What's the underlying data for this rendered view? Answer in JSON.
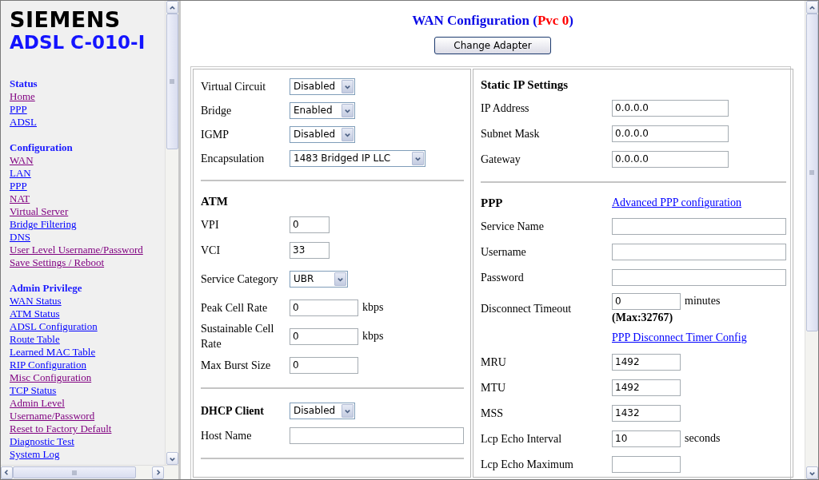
{
  "sidebar": {
    "brand": "SIEMENS",
    "model": "ADSL C-010-I",
    "sections": [
      {
        "title": "Status",
        "links": [
          {
            "label": "Home",
            "visited": true
          },
          {
            "label": "PPP",
            "visited": false
          },
          {
            "label": "ADSL",
            "visited": false
          }
        ]
      },
      {
        "title": "Configuration",
        "links": [
          {
            "label": "WAN",
            "visited": true
          },
          {
            "label": "LAN",
            "visited": false
          },
          {
            "label": "PPP",
            "visited": false
          },
          {
            "label": "NAT",
            "visited": true
          },
          {
            "label": "Virtual Server",
            "visited": true
          },
          {
            "label": "Bridge Filtering",
            "visited": false
          },
          {
            "label": "DNS",
            "visited": false
          },
          {
            "label": "User Level Username/Password",
            "visited": true
          },
          {
            "label": "Save Settings / Reboot",
            "visited": true
          }
        ]
      },
      {
        "title": "Admin Privilege",
        "links": [
          {
            "label": "WAN Status",
            "visited": false
          },
          {
            "label": "ATM Status",
            "visited": false
          },
          {
            "label": "ADSL Configuration",
            "visited": false
          },
          {
            "label": "Route Table",
            "visited": false
          },
          {
            "label": "Learned MAC Table",
            "visited": false
          },
          {
            "label": "RIP Configuration",
            "visited": false
          },
          {
            "label": "Misc Configuration",
            "visited": true
          },
          {
            "label": "TCP Status",
            "visited": false
          },
          {
            "label": "Admin Level",
            "visited": true
          },
          {
            "label": "Username/Password",
            "visited": true
          },
          {
            "label": "Reset to Factory Default",
            "visited": true
          },
          {
            "label": "Diagnostic Test",
            "visited": false
          },
          {
            "label": "System Log",
            "visited": false
          }
        ]
      }
    ]
  },
  "header": {
    "title_prefix": "WAN Configuration (",
    "pvc": "Pvc 0",
    "title_suffix": ")",
    "button": "Change Adapter"
  },
  "left_panel": [
    {
      "kind": "select",
      "label": "Virtual Circuit",
      "value": "Disabled"
    },
    {
      "kind": "select",
      "label": "Bridge",
      "value": "Enabled"
    },
    {
      "kind": "select",
      "label": "IGMP",
      "value": "Disabled"
    },
    {
      "kind": "select_wide",
      "label": "Encapsulation",
      "value": "1483 Bridged IP LLC"
    },
    {
      "kind": "divider"
    },
    {
      "kind": "heading",
      "label": "ATM"
    },
    {
      "kind": "input_short",
      "label": "VPI",
      "value": "0"
    },
    {
      "kind": "input_short",
      "label": "VCI",
      "value": "33"
    },
    {
      "kind": "select_short",
      "label": "Service Category",
      "value": "UBR"
    },
    {
      "kind": "input",
      "label": "Peak Cell Rate",
      "value": "0",
      "unit": "kbps"
    },
    {
      "kind": "input",
      "label": "Sustainable Cell Rate",
      "value": "0",
      "unit": "kbps"
    },
    {
      "kind": "input",
      "label": "Max Burst Size",
      "value": "0"
    },
    {
      "kind": "divider"
    },
    {
      "kind": "heading_select",
      "label": "DHCP Client",
      "value": "Disabled"
    },
    {
      "kind": "input_long",
      "label": "Host Name"
    },
    {
      "kind": "divider"
    }
  ],
  "right_panel": [
    {
      "kind": "heading",
      "label": "Static IP Settings"
    },
    {
      "kind": "input_ip",
      "label": "IP Address",
      "value": "0.0.0.0"
    },
    {
      "kind": "input_ip",
      "label": "Subnet Mask",
      "value": "0.0.0.0"
    },
    {
      "kind": "input_ip",
      "label": "Gateway",
      "value": "0.0.0.0"
    },
    {
      "kind": "divider"
    },
    {
      "kind": "heading_link",
      "label": "PPP",
      "link": "Advanced PPP configuration"
    },
    {
      "kind": "input_long",
      "label": "Service Name"
    },
    {
      "kind": "input_long",
      "label": "Username"
    },
    {
      "kind": "input_long",
      "label": "Password"
    },
    {
      "kind": "input_note",
      "label": "Disconnect Timeout",
      "value": "0",
      "unit": "minutes",
      "note": "(Max:32767)"
    },
    {
      "kind": "link",
      "link": "PPP Disconnect Timer Config"
    },
    {
      "kind": "input",
      "label": "MRU",
      "value": "1492"
    },
    {
      "kind": "input",
      "label": "MTU",
      "value": "1492"
    },
    {
      "kind": "input",
      "label": "MSS",
      "value": "1432"
    },
    {
      "kind": "input",
      "label": "Lcp Echo Interval",
      "value": "10",
      "unit": "seconds"
    },
    {
      "kind": "input",
      "label": "Lcp Echo Maximum"
    }
  ]
}
